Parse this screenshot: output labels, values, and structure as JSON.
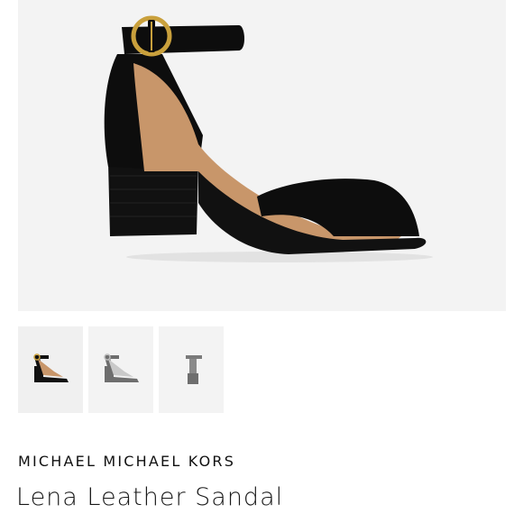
{
  "product": {
    "brand": "MICHAEL MICHAEL KORS",
    "name": "Lena Leather Sandal"
  },
  "gallery": {
    "main_image": "black-leather-block-heel-sandal",
    "thumbnails": [
      {
        "icon": "sandal-side-view",
        "color": "#111111",
        "selected": true
      },
      {
        "icon": "sandal-side-view",
        "color": "#6e6e6e",
        "selected": false
      },
      {
        "icon": "sandal-back-view",
        "color": "#7a7a7a",
        "selected": false
      }
    ]
  },
  "colors": {
    "leather": "#0d0d0d",
    "lining": "#c8966a",
    "buckle": "#c9a03c",
    "background": "#f3f3f3"
  }
}
